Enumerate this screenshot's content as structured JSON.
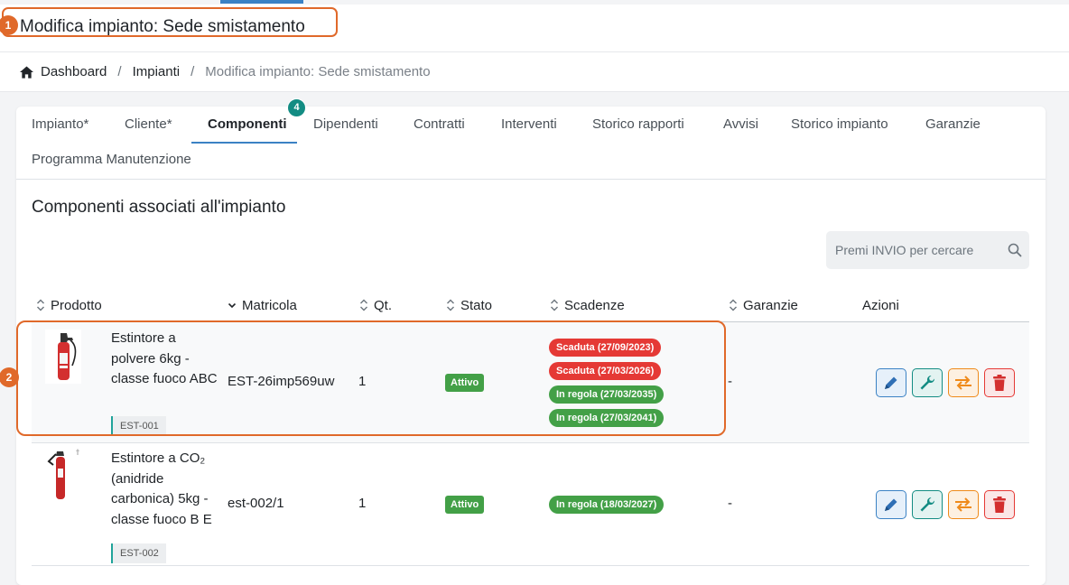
{
  "header": {
    "title": "Modifica impianto: Sede smistamento",
    "annotation_marker": "1"
  },
  "breadcrumb": {
    "home_icon": "home-icon",
    "items": [
      "Dashboard",
      "Impianti"
    ],
    "current": "Modifica impianto: Sede smistamento",
    "separator": "/"
  },
  "tabs": [
    {
      "label": "Impianto*"
    },
    {
      "label": "Cliente*"
    },
    {
      "label": "Componenti",
      "active": true,
      "badge": "4"
    },
    {
      "label": "Dipendenti"
    },
    {
      "label": "Contratti"
    },
    {
      "label": "Interventi"
    },
    {
      "label": "Storico rapporti"
    },
    {
      "label": "Avvisi"
    },
    {
      "label": "Storico impianto"
    },
    {
      "label": "Garanzie"
    },
    {
      "label": "Programma Manutenzione"
    }
  ],
  "section": {
    "title": "Componenti associati all'impianto",
    "search_placeholder": "Premi INVIO per cercare"
  },
  "table": {
    "columns": [
      "Prodotto",
      "Matricola",
      "Qt.",
      "Stato",
      "Scadenze",
      "Garanzie",
      "Azioni"
    ],
    "rows": [
      {
        "product": "Estintore a polvere 6kg - classe fuoco ABC",
        "code": "EST-001",
        "serial": "EST-26imp569uw",
        "qty": "1",
        "status": "Attivo",
        "deadlines": [
          {
            "label": "Scaduta (27/09/2023)",
            "kind": "expired"
          },
          {
            "label": "Scaduta (27/03/2026)",
            "kind": "expired"
          },
          {
            "label": "In regola (27/03/2035)",
            "kind": "ok"
          },
          {
            "label": "In regola (27/03/2041)",
            "kind": "ok"
          }
        ],
        "warranty": "-"
      },
      {
        "product": "Estintore a CO₂ (anidride carbonica) 5kg - classe fuoco B E",
        "code": "EST-002",
        "serial": "est-002/1",
        "qty": "1",
        "status": "Attivo",
        "deadlines": [
          {
            "label": "In regola (18/03/2027)",
            "kind": "ok"
          }
        ],
        "warranty": "-"
      }
    ],
    "row_annotation_marker": "2"
  },
  "colors": {
    "accent": "#3b82c4",
    "annotation": "#e0692a",
    "teal": "#138c83",
    "expired": "#e53935",
    "ok": "#43a047"
  }
}
